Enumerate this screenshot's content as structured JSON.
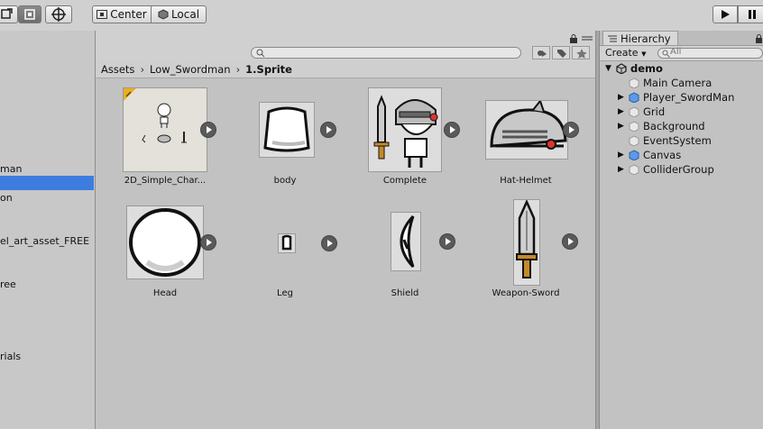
{
  "toolbar": {
    "pivot_label": "Center",
    "space_label": "Local"
  },
  "project_tree": {
    "items": [
      {
        "label": "man",
        "selected": false
      },
      {
        "label": "",
        "selected": true
      },
      {
        "label": "on",
        "selected": false
      },
      {
        "label": "el_art_asset_FREE",
        "selected": false
      },
      {
        "label": "ree",
        "selected": false
      },
      {
        "label": "rials",
        "selected": false
      }
    ]
  },
  "search": {
    "placeholder": ""
  },
  "breadcrumb": {
    "items": [
      "Assets",
      "Low_Swordman",
      "1.Sprite"
    ]
  },
  "assets": [
    {
      "label": "2D_Simple_Char..."
    },
    {
      "label": "body"
    },
    {
      "label": "Complete"
    },
    {
      "label": "Hat-Helmet"
    },
    {
      "label": "Head"
    },
    {
      "label": "Leg"
    },
    {
      "label": "Shield"
    },
    {
      "label": "Weapon-Sword"
    }
  ],
  "hierarchy": {
    "tab_label": "Hierarchy",
    "create_label": "Create",
    "search_placeholder": "All",
    "scene_name": "demo",
    "objects": [
      {
        "label": "Main Camera",
        "expandable": false,
        "icon": "gameobject-icon"
      },
      {
        "label": "Player_SwordMan",
        "expandable": true,
        "icon": "prefab-icon"
      },
      {
        "label": "Grid",
        "expandable": true,
        "icon": "gameobject-icon"
      },
      {
        "label": "Background",
        "expandable": true,
        "icon": "gameobject-icon"
      },
      {
        "label": "EventSystem",
        "expandable": false,
        "icon": "gameobject-icon"
      },
      {
        "label": "Canvas",
        "expandable": true,
        "icon": "prefab-icon"
      },
      {
        "label": "ColliderGroup",
        "expandable": true,
        "icon": "gameobject-icon"
      }
    ]
  }
}
